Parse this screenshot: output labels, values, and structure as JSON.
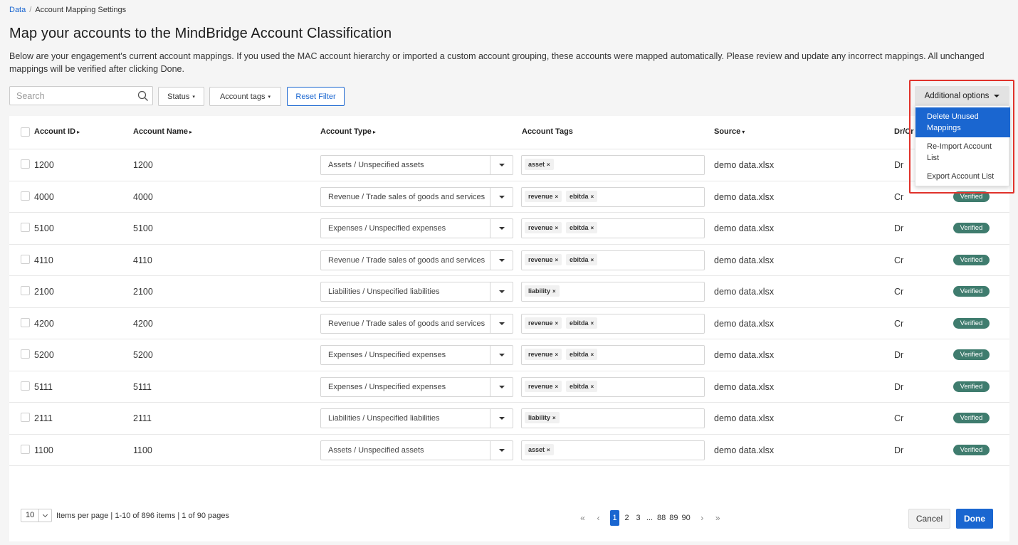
{
  "breadcrumb": {
    "parent": "Data",
    "separator": "/",
    "current": "Account Mapping Settings"
  },
  "page_title": "Map your accounts to the MindBridge Account Classification",
  "intro": "Below are your engagement's current account mappings. If you used the MAC account hierarchy or imported a custom account grouping, these accounts were mapped automatically. Please review and update any incorrect mappings. All unchanged mappings will be verified after clicking Done.",
  "filters": {
    "search_placeholder": "Search",
    "status_label": "Status",
    "tags_label": "Account tags",
    "reset_label": "Reset Filter",
    "caret": "▾"
  },
  "additional_options": {
    "label": "Additional options",
    "items": [
      "Delete Unused Mappings",
      "Re-Import Account List",
      "Export Account List"
    ]
  },
  "table": {
    "headers": {
      "account_id": "Account ID",
      "account_name": "Account Name",
      "account_type": "Account Type",
      "account_tags": "Account Tags",
      "source": "Source",
      "dr_cr": "Dr/Cr"
    },
    "sort_right": "▸",
    "sort_down": "▾",
    "rows": [
      {
        "id": "1200",
        "name": "1200",
        "type": "Assets / Unspecified assets",
        "tags": [
          "asset"
        ],
        "source": "demo data.xlsx",
        "drcr": "Dr",
        "status": ""
      },
      {
        "id": "4000",
        "name": "4000",
        "type": "Revenue / Trade sales of goods and services",
        "tags": [
          "revenue",
          "ebitda"
        ],
        "source": "demo data.xlsx",
        "drcr": "Cr",
        "status": "Verified"
      },
      {
        "id": "5100",
        "name": "5100",
        "type": "Expenses / Unspecified expenses",
        "tags": [
          "revenue",
          "ebitda"
        ],
        "source": "demo data.xlsx",
        "drcr": "Dr",
        "status": "Verified"
      },
      {
        "id": "4110",
        "name": "4110",
        "type": "Revenue / Trade sales of goods and services",
        "tags": [
          "revenue",
          "ebitda"
        ],
        "source": "demo data.xlsx",
        "drcr": "Cr",
        "status": "Verified"
      },
      {
        "id": "2100",
        "name": "2100",
        "type": "Liabilities / Unspecified liabilities",
        "tags": [
          "liability"
        ],
        "source": "demo data.xlsx",
        "drcr": "Cr",
        "status": "Verified"
      },
      {
        "id": "4200",
        "name": "4200",
        "type": "Revenue / Trade sales of goods and services",
        "tags": [
          "revenue",
          "ebitda"
        ],
        "source": "demo data.xlsx",
        "drcr": "Cr",
        "status": "Verified"
      },
      {
        "id": "5200",
        "name": "5200",
        "type": "Expenses / Unspecified expenses",
        "tags": [
          "revenue",
          "ebitda"
        ],
        "source": "demo data.xlsx",
        "drcr": "Dr",
        "status": "Verified"
      },
      {
        "id": "5111",
        "name": "5111",
        "type": "Expenses / Unspecified expenses",
        "tags": [
          "revenue",
          "ebitda"
        ],
        "source": "demo data.xlsx",
        "drcr": "Dr",
        "status": "Verified"
      },
      {
        "id": "2111",
        "name": "2111",
        "type": "Liabilities / Unspecified liabilities",
        "tags": [
          "liability"
        ],
        "source": "demo data.xlsx",
        "drcr": "Cr",
        "status": "Verified"
      },
      {
        "id": "1100",
        "name": "1100",
        "type": "Assets / Unspecified assets",
        "tags": [
          "asset"
        ],
        "source": "demo data.xlsx",
        "drcr": "Dr",
        "status": "Verified"
      }
    ],
    "tag_remove": "×"
  },
  "footer": {
    "per_page_value": "10",
    "items_info": "Items per page | 1-10 of 896 items | 1 of 90 pages",
    "pages": [
      "«",
      "‹",
      "1",
      "2",
      "3",
      "...",
      "88",
      "89",
      "90",
      "›",
      "»"
    ],
    "current_page": "1",
    "cancel_label": "Cancel",
    "done_label": "Done"
  },
  "colors": {
    "accent": "#1a66d0",
    "verified": "#3f7c6e",
    "highlight": "#e0322b"
  }
}
